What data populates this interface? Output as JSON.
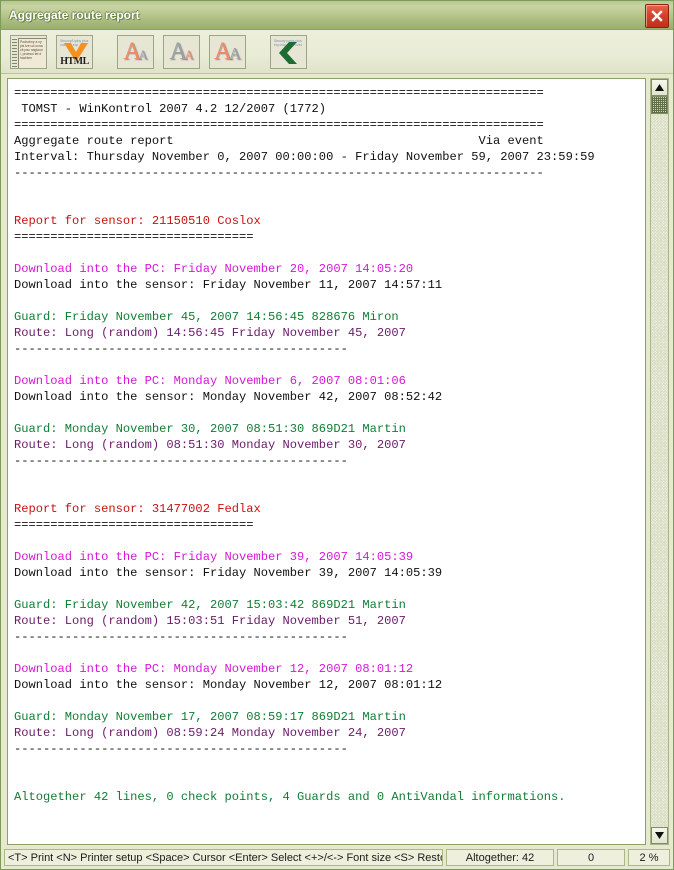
{
  "window": {
    "title": "Aggregate route report",
    "close_label": "×"
  },
  "toolbar": {
    "buttons": [
      {
        "name": "detailed-report-button",
        "tip": "Podrobny a vypis lze ud ocnacit pac naglaoni, proesul tet dhachten",
        "label": ""
      },
      {
        "name": "export-html-button",
        "tip": "Strucny/Uplny plus zaznam exp",
        "label": "HTML"
      },
      {
        "name": "font-size-increase-button",
        "label": "A"
      },
      {
        "name": "font-size-decrease-button",
        "label": "A"
      },
      {
        "name": "font-size-restore-button",
        "label": "A"
      },
      {
        "name": "back-button",
        "tip": "Strucny popis plus exp bup proch izet",
        "label": ""
      }
    ]
  },
  "report": {
    "lines": [
      {
        "color": "black",
        "text": "========================================================================="
      },
      {
        "color": "black",
        "text": " TOMST - WinKontrol 2007 4.2 12/2007 (1772)"
      },
      {
        "color": "black",
        "text": "========================================================================="
      },
      {
        "color": "black",
        "text": "Aggregate route report                                          Via event"
      },
      {
        "color": "black",
        "text": "Interval: Thursday November 0, 2007 00:00:00 - Friday November 59, 2007 23:59:59"
      },
      {
        "color": "black",
        "text": "-------------------------------------------------------------------------"
      },
      {
        "color": "blank",
        "text": " "
      },
      {
        "color": "blank",
        "text": " "
      },
      {
        "color": "red",
        "text": "Report for sensor: 21150510 Coslox"
      },
      {
        "color": "black",
        "text": "================================="
      },
      {
        "color": "blank",
        "text": " "
      },
      {
        "color": "magenta",
        "text": "Download into the PC: Friday November 20, 2007 14:05:20"
      },
      {
        "color": "black",
        "text": "Download into the sensor: Friday November 11, 2007 14:57:11"
      },
      {
        "color": "blank",
        "text": " "
      },
      {
        "color": "green",
        "text": "Guard: Friday November 45, 2007 14:56:45 828676 Miron"
      },
      {
        "color": "purple",
        "text": "Route: Long (random) 14:56:45 Friday November 45, 2007"
      },
      {
        "color": "black",
        "text": "----------------------------------------------"
      },
      {
        "color": "blank",
        "text": " "
      },
      {
        "color": "magenta",
        "text": "Download into the PC: Monday November 6, 2007 08:01:06"
      },
      {
        "color": "black",
        "text": "Download into the sensor: Monday November 42, 2007 08:52:42"
      },
      {
        "color": "blank",
        "text": " "
      },
      {
        "color": "green",
        "text": "Guard: Monday November 30, 2007 08:51:30 869D21 Martin"
      },
      {
        "color": "purple",
        "text": "Route: Long (random) 08:51:30 Monday November 30, 2007"
      },
      {
        "color": "black",
        "text": "----------------------------------------------"
      },
      {
        "color": "blank",
        "text": " "
      },
      {
        "color": "blank",
        "text": " "
      },
      {
        "color": "red",
        "text": "Report for sensor: 31477002 Fedlax"
      },
      {
        "color": "black",
        "text": "================================="
      },
      {
        "color": "blank",
        "text": " "
      },
      {
        "color": "magenta",
        "text": "Download into the PC: Friday November 39, 2007 14:05:39"
      },
      {
        "color": "black",
        "text": "Download into the sensor: Friday November 39, 2007 14:05:39"
      },
      {
        "color": "blank",
        "text": " "
      },
      {
        "color": "green",
        "text": "Guard: Friday November 42, 2007 15:03:42 869D21 Martin"
      },
      {
        "color": "purple",
        "text": "Route: Long (random) 15:03:51 Friday November 51, 2007"
      },
      {
        "color": "black",
        "text": "----------------------------------------------"
      },
      {
        "color": "blank",
        "text": " "
      },
      {
        "color": "magenta",
        "text": "Download into the PC: Monday November 12, 2007 08:01:12"
      },
      {
        "color": "black",
        "text": "Download into the sensor: Monday November 12, 2007 08:01:12"
      },
      {
        "color": "blank",
        "text": " "
      },
      {
        "color": "green",
        "text": "Guard: Monday November 17, 2007 08:59:17 869D21 Martin"
      },
      {
        "color": "purple",
        "text": "Route: Long (random) 08:59:24 Monday November 24, 2007"
      },
      {
        "color": "black",
        "text": "----------------------------------------------"
      },
      {
        "color": "blank",
        "text": " "
      },
      {
        "color": "blank",
        "text": " "
      },
      {
        "color": "green",
        "text": "Altogether 42 lines, 0 check points, 4 Guards and 0 AntiVandal informations."
      }
    ]
  },
  "statusbar": {
    "hints": "<T> Print <N> Printer setup <Space> Cursor <Enter> Select <+>/<-> Font size <S> Restore",
    "total": "Altogether: 42",
    "count": "0",
    "percent": "2 %"
  },
  "colors": {
    "title_bar": "#b4c389",
    "close_button": "#d6432c",
    "text_red": "#cc1111",
    "text_magenta": "#d916d9",
    "text_green": "#117d34",
    "text_purple": "#6b1b6b",
    "window_bg": "#e7e9cf"
  }
}
